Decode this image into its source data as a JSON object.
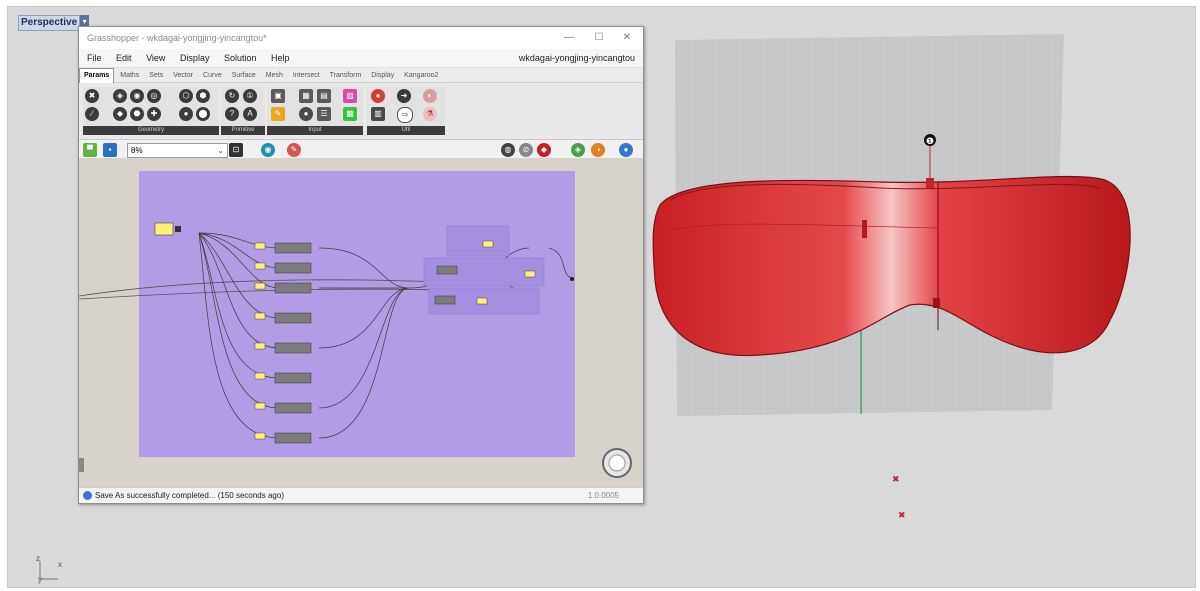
{
  "viewport": {
    "label": "Perspective",
    "caret": "▾",
    "axis": {
      "z": "z",
      "x": "x",
      "y": "y"
    },
    "point_marker": "❶"
  },
  "grasshopper": {
    "title": "Grasshopper - wkdagai-yongjing-yincangtou*",
    "window_controls": {
      "minimize": "—",
      "maximize": "☐",
      "close": "✕"
    },
    "menu": [
      "File",
      "Edit",
      "View",
      "Display",
      "Solution",
      "Help"
    ],
    "document_name": "wkdagai-yongjing-yincangtou",
    "tabs": [
      "Params",
      "Maths",
      "Sets",
      "Vector",
      "Curve",
      "Surface",
      "Mesh",
      "Intersect",
      "Transform",
      "Display",
      "Kangaroo2"
    ],
    "panels": [
      "Geometry",
      "Primitive",
      "Input",
      "Util"
    ],
    "zoom": "8%",
    "status": "Save As successfully completed... (150 seconds ago)",
    "version": "1.0.0005",
    "colors": {
      "canvas_group": "#b39ce6",
      "canvas_bg": "#d7d3cb",
      "panel_yellow": "#fff176"
    }
  },
  "rhino": {
    "colors": {
      "mask_fill": "#d9282b",
      "grid": "#b9bcbf",
      "green_axis": "#2a9b3a",
      "red_marker": "#c0262a"
    }
  }
}
